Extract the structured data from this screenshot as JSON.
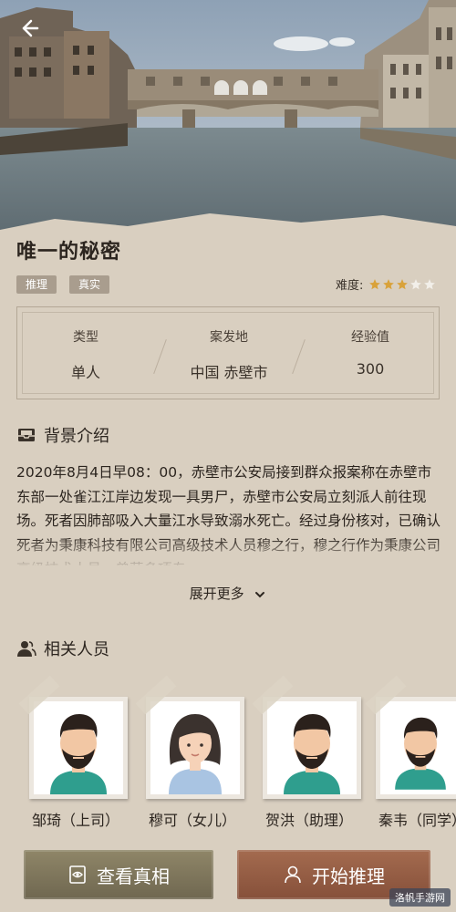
{
  "case": {
    "title": "唯一的秘密",
    "tags": [
      "推理",
      "真实"
    ],
    "difficulty_label": "难度:",
    "difficulty_value": 3,
    "difficulty_max": 5
  },
  "info": [
    {
      "label": "类型",
      "value": "单人"
    },
    {
      "label": "案发地",
      "value": "中国 赤壁市"
    },
    {
      "label": "经验值",
      "value": "300"
    }
  ],
  "background": {
    "heading": "背景介绍",
    "text": "2020年8月4日早08：00，赤壁市公安局接到群众报案称在赤壁市东部一处雀江江岸边发现一具男尸，赤壁市公安局立刻派人前往现场。死者因肺部吸入大量江水导致溺水死亡。经过身份核对，已确认死者为秉康科技有限公司高级技术人员穆之行，穆之行作为秉康公司高级技术人员，曾获多项专",
    "expand_label": "展开更多"
  },
  "people": {
    "heading": "相关人员",
    "list": [
      {
        "name": "邹琦（上司）",
        "gender": "male"
      },
      {
        "name": "穆可（女儿）",
        "gender": "female"
      },
      {
        "name": "贺洪（助理）",
        "gender": "male"
      },
      {
        "name": "秦韦（同学）",
        "gender": "male"
      }
    ]
  },
  "actions": {
    "view_truth": "查看真相",
    "start": "开始推理"
  },
  "watermark": "洛帆手游网",
  "colors": {
    "star_on": "#d9a23a",
    "star_off": "#f2efe9",
    "accent_brown": "#86503a"
  }
}
